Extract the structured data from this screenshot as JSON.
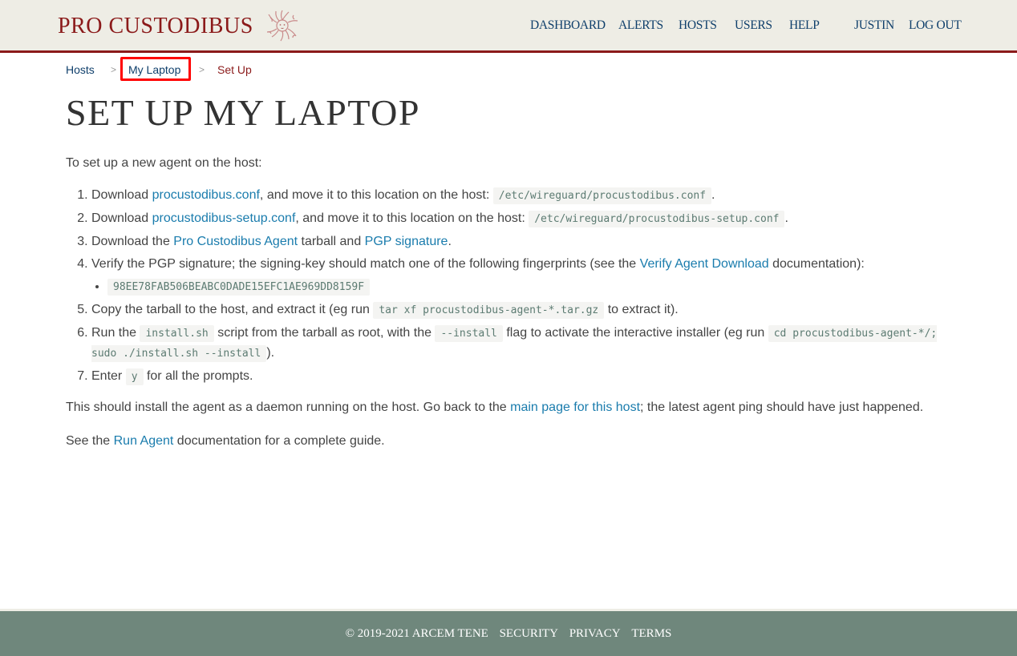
{
  "header": {
    "brand": "PRO CUSTODIBUS",
    "logo_icon": "medusa-head-icon",
    "brand_color": "#8b1a1a",
    "nav": [
      {
        "label": "DASHBOARD"
      },
      {
        "label": "ALERTS"
      },
      {
        "label": "HOSTS"
      },
      {
        "label": "USERS"
      },
      {
        "label": "HELP"
      }
    ],
    "user": "JUSTIN",
    "logout": "LOG OUT"
  },
  "breadcrumb": {
    "items": [
      "Hosts",
      "My Laptop",
      "Set Up"
    ],
    "separator": ">"
  },
  "page_title": "SET UP MY LAPTOP",
  "intro": "To set up a new agent on the host:",
  "steps": {
    "s1": {
      "pre": "Download ",
      "link": "procustodibus.conf",
      "mid": ", and move it to this location on the host: ",
      "code": "/etc/wireguard/procustodibus.conf",
      "post": "."
    },
    "s2": {
      "pre": "Download ",
      "link": "procustodibus-setup.conf",
      "mid": ", and move it to this location on the host: ",
      "code": "/etc/wireguard/procustodibus-setup.conf",
      "post": "."
    },
    "s3": {
      "pre": "Download the ",
      "link1": "Pro Custodibus Agent",
      "mid": " tarball and ",
      "link2": "PGP signature",
      "post": "."
    },
    "s4": {
      "pre": "Verify the PGP signature; the signing-key should match one of the following fingerprints (see the ",
      "link": "Verify Agent Download",
      "post": " documentation):",
      "fingerprints": [
        "98EE78FAB506BEABC0DADE15EFC1AE969DD8159F"
      ]
    },
    "s5": {
      "pre": "Copy the tarball to the host, and extract it (eg run ",
      "code": "tar xf procustodibus-agent-*.tar.gz",
      "post": " to extract it)."
    },
    "s6": {
      "pre": "Run the ",
      "code1": "install.sh",
      "mid1": " script from the tarball as root, with the ",
      "code2": "--install",
      "mid2": " flag to activate the interactive installer (eg run ",
      "code3": "cd procustodibus-agent-*/; sudo ./install.sh --install",
      "post": ")."
    },
    "s7": {
      "pre": "Enter ",
      "code": "y",
      "post": " for all the prompts."
    }
  },
  "after": {
    "pre": "This should install the agent as a daemon running on the host. Go back to the ",
    "link": "main page for this host",
    "post": "; the latest agent ping should have just happened."
  },
  "see": {
    "pre": "See the ",
    "link": "Run Agent",
    "post": " documentation for a complete guide."
  },
  "footer": {
    "copyright": "© 2019-2021 ARCEM TENE",
    "links": [
      "SECURITY",
      "PRIVACY",
      "TERMS"
    ]
  }
}
